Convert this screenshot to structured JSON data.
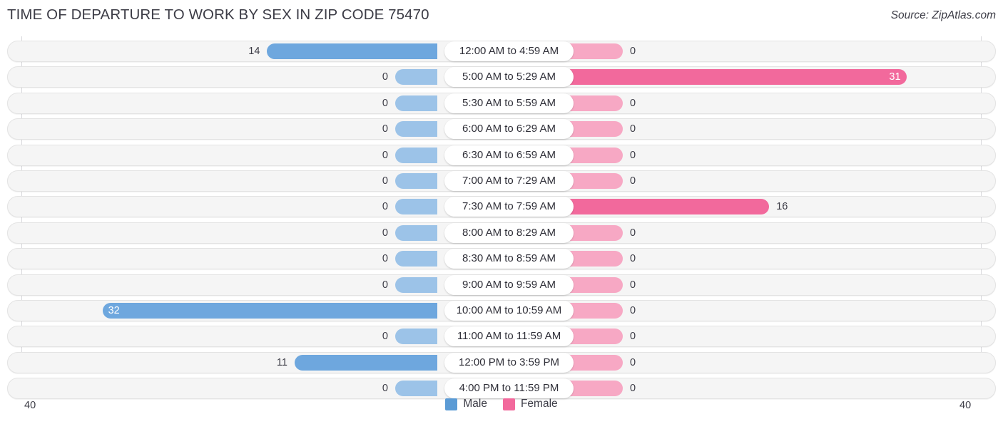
{
  "header": {
    "title": "TIME OF DEPARTURE TO WORK BY SEX IN ZIP CODE 75470",
    "source": "Source: ZipAtlas.com"
  },
  "legend": {
    "male_label": "Male",
    "female_label": "Female",
    "male_color": "#5B9BD5",
    "female_color": "#F2699C"
  },
  "axis": {
    "left_end": "40",
    "right_end": "40"
  },
  "colors": {
    "male_light": "#9CC3E8",
    "male_dark": "#6EA7DE",
    "female_light": "#F7A8C4",
    "female_dark": "#F2699C",
    "row_bg": "#f5f5f5",
    "row_border": "#e3e3e3"
  },
  "chart_data": {
    "type": "bar",
    "title": "TIME OF DEPARTURE TO WORK BY SEX IN ZIP CODE 75470",
    "subtitle": "",
    "xlabel": "",
    "ylabel": "",
    "orientation": "horizontal-diverging",
    "grid": true,
    "legend_position": "bottom-center",
    "xlim": [
      40,
      40
    ],
    "axis_max": 40,
    "categories": [
      "12:00 AM to 4:59 AM",
      "5:00 AM to 5:29 AM",
      "5:30 AM to 5:59 AM",
      "6:00 AM to 6:29 AM",
      "6:30 AM to 6:59 AM",
      "7:00 AM to 7:29 AM",
      "7:30 AM to 7:59 AM",
      "8:00 AM to 8:29 AM",
      "8:30 AM to 8:59 AM",
      "9:00 AM to 9:59 AM",
      "10:00 AM to 10:59 AM",
      "11:00 AM to 11:59 AM",
      "12:00 PM to 3:59 PM",
      "4:00 PM to 11:59 PM"
    ],
    "series": [
      {
        "name": "Male",
        "side": "left",
        "values": [
          14,
          0,
          0,
          0,
          0,
          0,
          0,
          0,
          0,
          0,
          32,
          0,
          11,
          0
        ]
      },
      {
        "name": "Female",
        "side": "right",
        "values": [
          0,
          31,
          0,
          0,
          0,
          0,
          16,
          0,
          0,
          0,
          0,
          0,
          0,
          0
        ]
      }
    ]
  }
}
